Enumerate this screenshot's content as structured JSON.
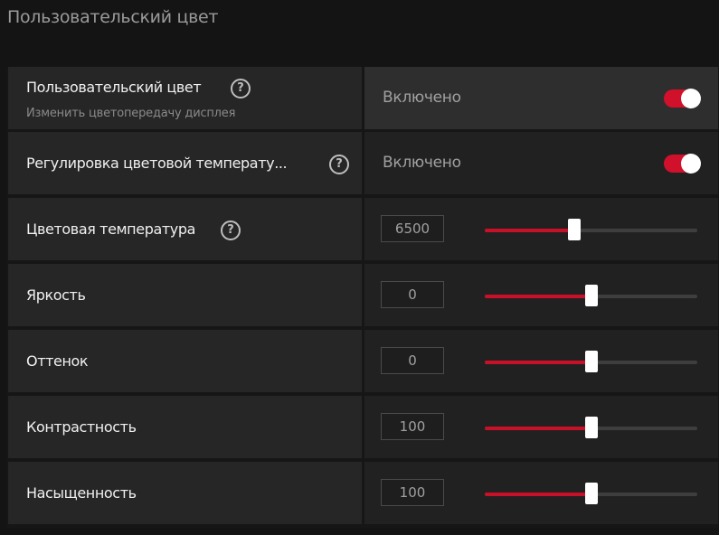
{
  "page_title": "Пользовательский цвет",
  "rows": [
    {
      "label": "Пользовательский цвет",
      "sublabel": "Изменить цветопередачу дисплея",
      "state": "Включено",
      "toggle_on": true
    },
    {
      "label": "Регулировка цветовой температу...",
      "state": "Включено",
      "toggle_on": true
    },
    {
      "label": "Цветовая температура",
      "value": "6500",
      "slider_fraction": 0.42
    },
    {
      "label": "Яркость",
      "value": "0",
      "slider_fraction": 0.5
    },
    {
      "label": "Оттенок",
      "value": "0",
      "slider_fraction": 0.5
    },
    {
      "label": "Контрастность",
      "value": "100",
      "slider_fraction": 0.5
    },
    {
      "label": "Насыщенность",
      "value": "100",
      "slider_fraction": 0.5
    }
  ],
  "help_symbol": "?",
  "colors": {
    "accent": "#d1112c",
    "background": "#141414",
    "row_left": "#262626",
    "row_right": "#212121"
  },
  "icons": {
    "help": "question-circle-icon"
  }
}
